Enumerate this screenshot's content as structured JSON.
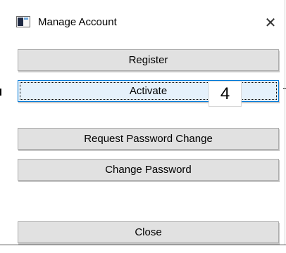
{
  "window": {
    "title": "Manage Account",
    "close_glyph": "✕",
    "app_icon": "app-window-icon"
  },
  "buttons": {
    "register": "Register",
    "activate": "Activate",
    "request_password_change": "Request Password Change",
    "change_password": "Change Password",
    "close": "Close"
  },
  "badge": {
    "text": "4"
  },
  "colors": {
    "button_face": "#e1e1e1",
    "button_border": "#adadad",
    "focus_border": "#0078d7",
    "focus_face": "#e5f1fb"
  }
}
